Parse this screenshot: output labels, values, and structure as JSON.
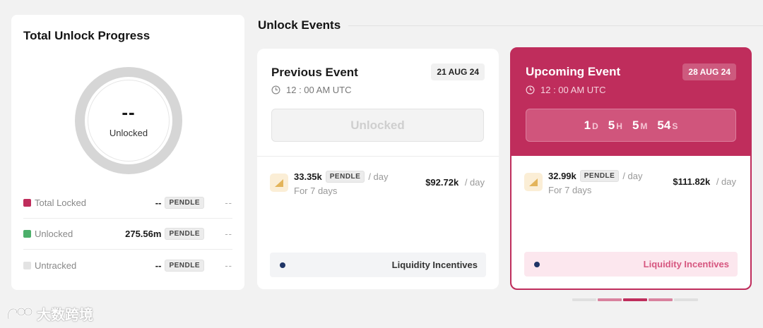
{
  "progress": {
    "title": "Total Unlock Progress",
    "ring_value": "--",
    "ring_label": "Unlocked",
    "legend": [
      {
        "label": "Total Locked",
        "amount": "--",
        "token": "PENDLE",
        "trail": "--",
        "color": "#bf2d5c"
      },
      {
        "label": "Unlocked",
        "amount": "275.56m",
        "token": "PENDLE",
        "trail": "--",
        "color": "#4caf6a"
      },
      {
        "label": "Untracked",
        "amount": "--",
        "token": "PENDLE",
        "trail": "--",
        "color": "#e3e3e3"
      }
    ]
  },
  "events": {
    "section_title": "Unlock Events",
    "previous": {
      "title": "Previous Event",
      "date": "21 AUG 24",
      "time": "12 : 00 AM UTC",
      "status": "Unlocked",
      "amount": "33.35k",
      "token": "PENDLE",
      "per_day": "/ day",
      "duration": "For 7 days",
      "usd": "$92.72k",
      "usd_per": "/ day",
      "category": "Liquidity Incentives"
    },
    "upcoming": {
      "title": "Upcoming Event",
      "date": "28 AUG 24",
      "time": "12 : 00 AM UTC",
      "countdown": [
        {
          "num": "1",
          "unit": "D"
        },
        {
          "num": "5",
          "unit": "H"
        },
        {
          "num": "5",
          "unit": "M"
        },
        {
          "num": "54",
          "unit": "S"
        }
      ],
      "amount": "32.99k",
      "token": "PENDLE",
      "per_day": "/ day",
      "duration": "For 7 days",
      "usd": "$111.82k",
      "usd_per": "/ day",
      "category": "Liquidity Incentives"
    }
  },
  "pager": {
    "active_index": 2,
    "segment_colors": [
      "#e0e0e0",
      "#d9839f",
      "#bf2d5c",
      "#d9839f",
      "#e0e0e0"
    ]
  },
  "watermark": {
    "text": "大数跨境"
  }
}
